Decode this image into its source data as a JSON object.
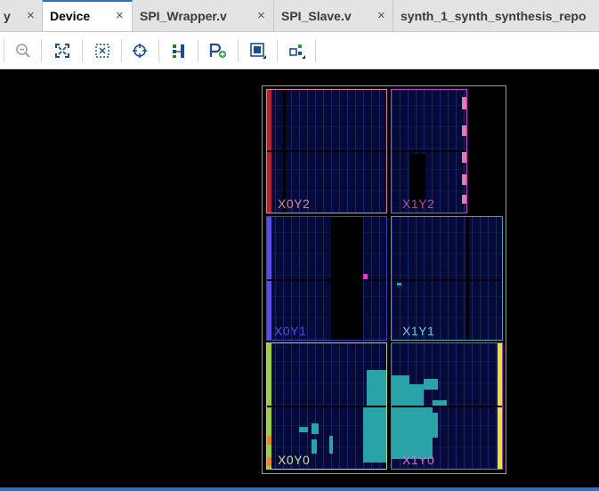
{
  "tabs": [
    {
      "label": "y",
      "active": false
    },
    {
      "label": "Device",
      "active": true
    },
    {
      "label": "SPI_Wrapper.v",
      "active": false
    },
    {
      "label": "SPI_Slave.v",
      "active": false
    },
    {
      "label": "synth_1_synth_synthesis_repo",
      "active": false
    }
  ],
  "close_glyph": "×",
  "toolbar": {
    "buttons": [
      {
        "name": "zoom-out-icon"
      },
      {
        "name": "zoom-fit-icon"
      },
      {
        "name": "zoom-to-selection-icon"
      },
      {
        "name": "auto-fit-selection-icon"
      },
      {
        "name": "routing-resources-icon"
      },
      {
        "name": "add-pblock-icon"
      },
      {
        "name": "draw-box-icon"
      },
      {
        "name": "split-pblock-icon"
      }
    ]
  },
  "regions": {
    "x0y2": {
      "label": "X0Y2",
      "color": "#e07fa6"
    },
    "x1y2": {
      "label": "X1Y2",
      "color": "#c63cc7"
    },
    "x0y1": {
      "label": "X0Y1",
      "color": "#4a4fe0"
    },
    "x1y1": {
      "label": "X1Y1",
      "color": "#5fd0d8"
    },
    "x0y0": {
      "label": "X0Y0",
      "color": "#c8e080"
    },
    "x1y0": {
      "label": "X1Y0",
      "color": "#e060d8"
    }
  },
  "colors": {
    "active_tab_accent": "#2f6fbf",
    "placed_cells": "#2aa3a8",
    "fabric": "#050a38"
  }
}
